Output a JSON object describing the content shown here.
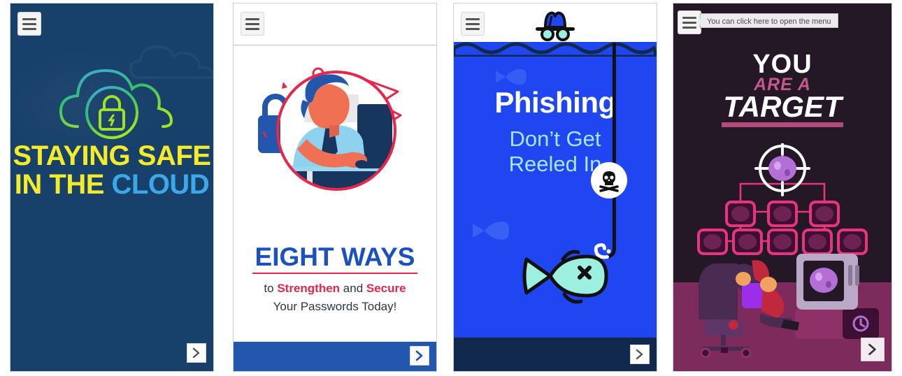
{
  "slides": [
    {
      "id": "staying-safe-in-the-cloud",
      "menu_icon": "hamburger-menu-icon",
      "next_icon": "chevron-right-icon",
      "title_line1": "STAYING SAFE",
      "title_line2_part1": "IN THE ",
      "title_line2_part2": "CLOUD",
      "artwork": "cloud-lock-icon",
      "colors": {
        "background": "#17406a",
        "title_yellow": "#f4eb2a",
        "title_blue": "#3ca8e8",
        "icon_blue": "#3ca8e8",
        "icon_green": "#35c06a",
        "icon_lime": "#9fe424"
      }
    },
    {
      "id": "eight-ways-passwords",
      "menu_icon": "hamburger-menu-icon",
      "next_icon": "chevron-right-icon",
      "headline": "EIGHT WAYS",
      "sub_prefix": "to ",
      "sub_word1": "Strengthen",
      "sub_mid": " and ",
      "sub_word2": "Secure",
      "sub_line2": "Your Passwords Today!",
      "artwork": "man-at-computer-illustration",
      "colors": {
        "background": "#ffffff",
        "headline_blue": "#1b50c0",
        "accent_red": "#e8254a",
        "footer_blue": "#2257ad",
        "body_text": "#2f3640"
      }
    },
    {
      "id": "phishing-dont-get-reeled-in",
      "menu_icon": "hamburger-menu-icon",
      "next_icon": "chevron-right-icon",
      "title": "Phishing",
      "subtitle_line1": "Don’t Get",
      "subtitle_line2": "Reeled In",
      "artwork": "fish-on-hook-illustration",
      "decor_icons": [
        "incognito-hat-icon",
        "skull-crossbones-icon",
        "fish-icon"
      ],
      "colors": {
        "water": "#1f46f0",
        "sky": "#ffffff",
        "footer": "#10294c",
        "title": "#ffffff",
        "subtitle": "#a7e6fb",
        "fish": "#9df0e0"
      }
    },
    {
      "id": "you-are-a-target",
      "menu_icon": "hamburger-menu-icon",
      "next_icon": "chevron-right-icon",
      "tooltip": "You can click here to open the menu",
      "title_line1": "YOU",
      "title_line2": "ARE A",
      "title_line3": "TARGET",
      "artwork": "hacker-at-computer-network-target-illustration",
      "colors": {
        "background": "#241726",
        "floor": "#7d2a5c",
        "pink": "#c2588c",
        "node_pink": "#e8347f",
        "white": "#ffffff",
        "ghost_purple": "#b36fd6"
      }
    }
  ]
}
